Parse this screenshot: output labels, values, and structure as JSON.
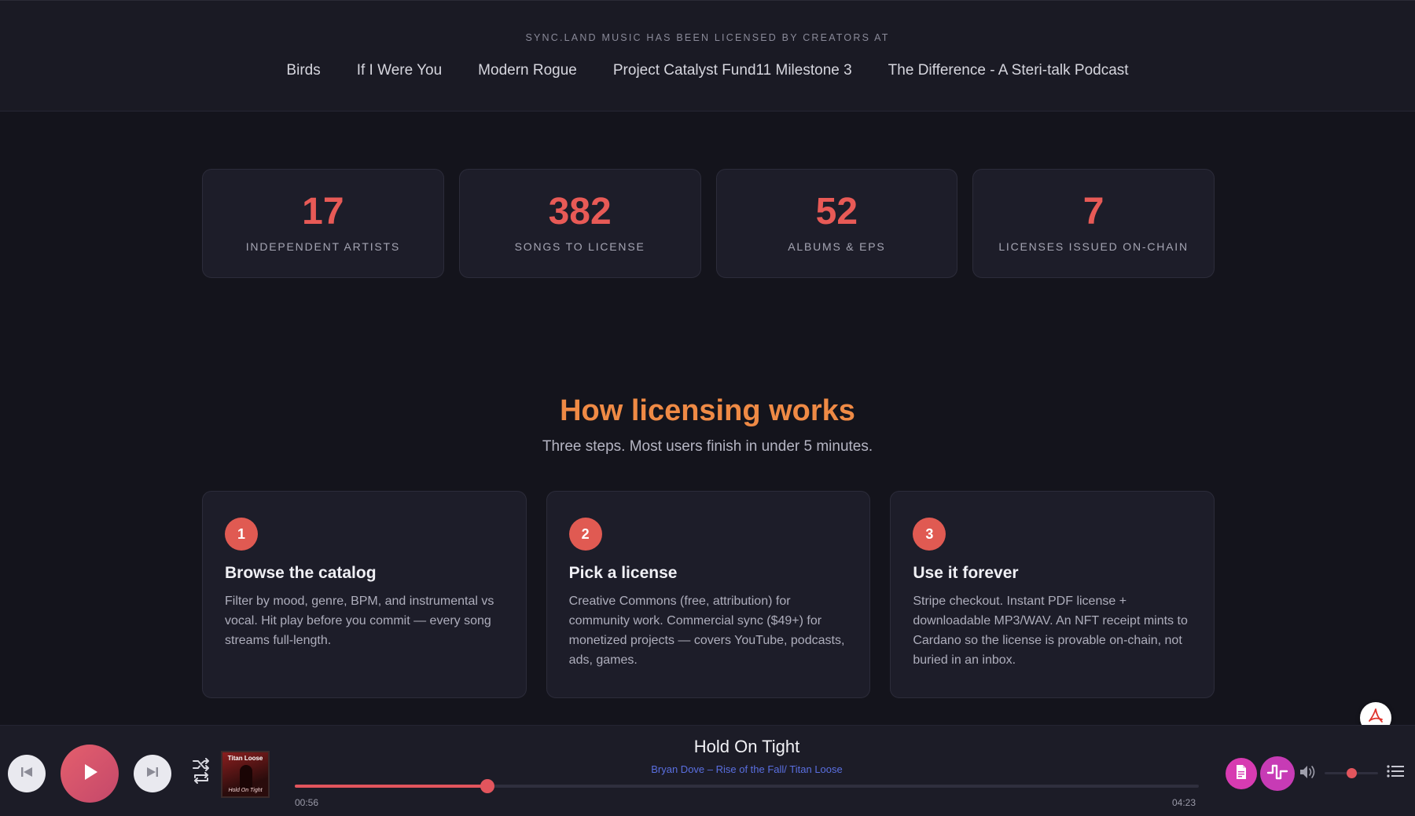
{
  "licensed_band": {
    "caption": "SYNC.LAND MUSIC HAS BEEN LICENSED BY CREATORS AT",
    "items": [
      "Birds",
      "If I Were You",
      "Modern Rogue",
      "Project Catalyst Fund11 Milestone 3",
      "The Difference - A Steri-talk Podcast"
    ]
  },
  "stats": [
    {
      "value": "17",
      "label": "INDEPENDENT ARTISTS"
    },
    {
      "value": "382",
      "label": "SONGS TO LICENSE"
    },
    {
      "value": "52",
      "label": "ALBUMS & EPS"
    },
    {
      "value": "7",
      "label": "LICENSES ISSUED ON-CHAIN"
    }
  ],
  "how": {
    "title": "How licensing works",
    "subtitle": "Three steps. Most users finish in under 5 minutes.",
    "steps": [
      {
        "num": "1",
        "title": "Browse the catalog",
        "desc": "Filter by mood, genre, BPM, and instrumental vs vocal. Hit play before you commit — every song streams full-length."
      },
      {
        "num": "2",
        "title": "Pick a license",
        "desc": "Creative Commons (free, attribution) for community work. Commercial sync ($49+) for monetized projects — covers YouTube, podcasts, ads, games."
      },
      {
        "num": "3",
        "title": "Use it forever",
        "desc": "Stripe checkout. Instant PDF license + downloadable MP3/WAV. An NFT receipt mints to Cardano so the license is provable on-chain, not buried in an inbox."
      }
    ]
  },
  "player": {
    "track_title": "Hold On Tight",
    "artist_album": "Bryan Dove – Rise of the Fall/ Titan Loose",
    "cover_title": "Titan Loose",
    "cover_subtitle": "Hold On Tight",
    "elapsed": "00:56",
    "total": "04:23",
    "progress": 0.213,
    "volume": 0.5,
    "icons": {
      "prev": "skip-previous-icon",
      "play": "play-icon",
      "next": "skip-next-icon",
      "shuffle": "shuffle-repeat-icon",
      "license": "document-icon",
      "wave": "waveform-icon",
      "volume": "volume-icon",
      "queue": "queue-list-icon",
      "pdf": "pdf-icon"
    },
    "colors": {
      "accent": "#e2555d",
      "play_gradient_start": "#e45f6d",
      "license_btn": "#d73bb1",
      "artist_link": "#5a6fe0"
    }
  }
}
